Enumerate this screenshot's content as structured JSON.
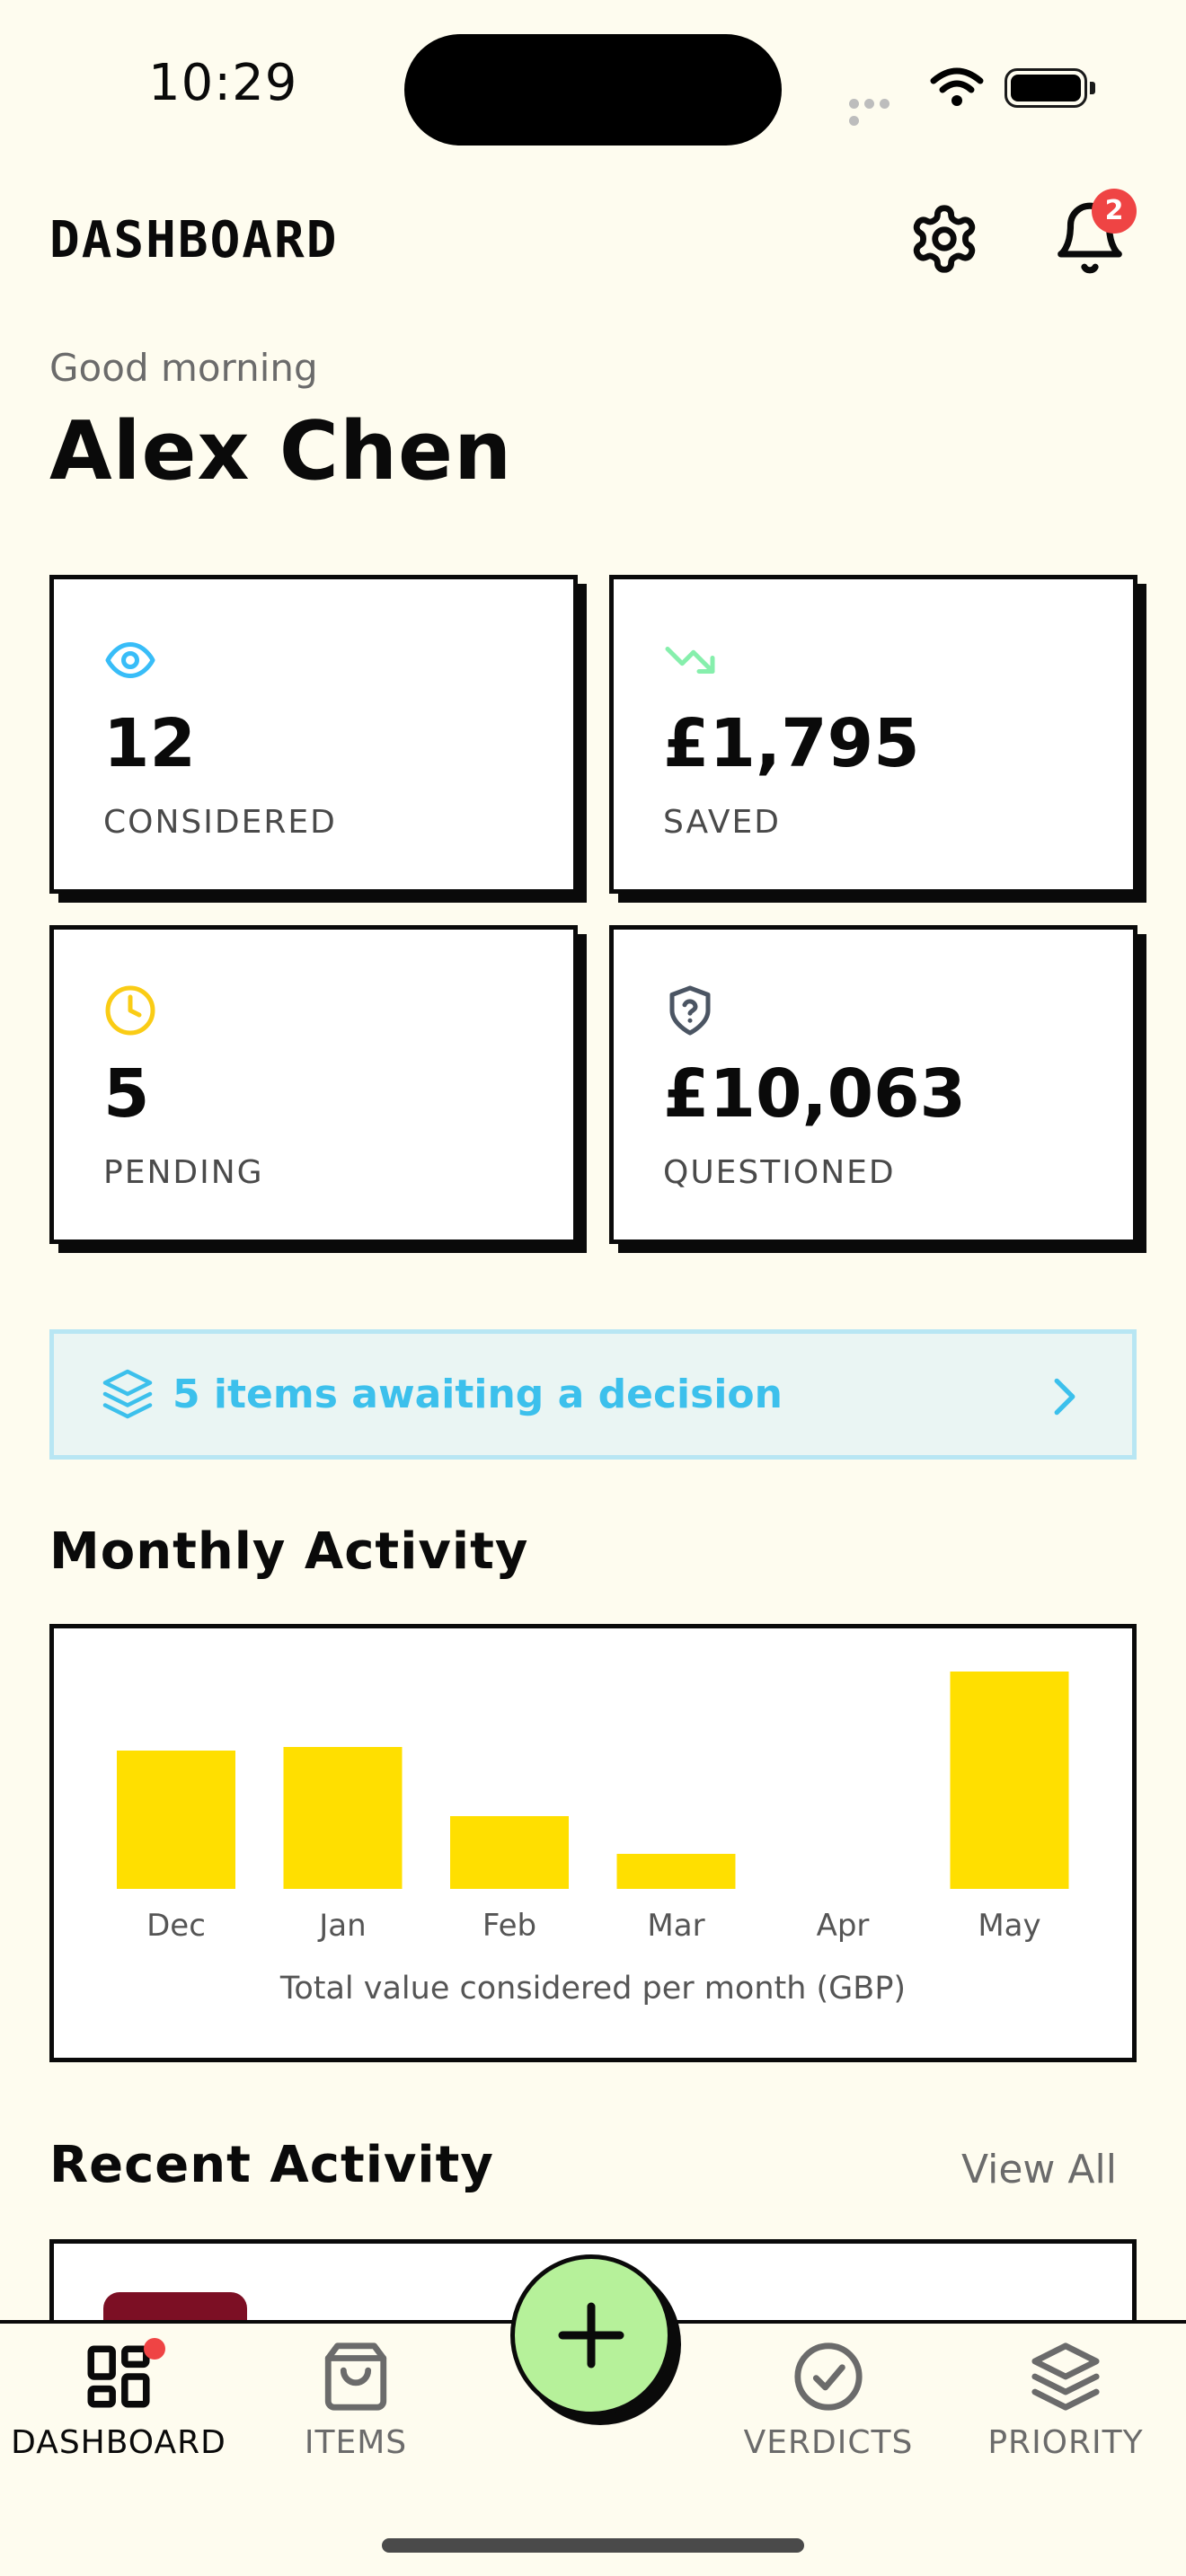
{
  "status_bar": {
    "time": "10:29"
  },
  "header": {
    "title": "DASHBOARD",
    "notification_count": "2"
  },
  "greeting": {
    "salutation": "Good morning",
    "name": "Alex Chen"
  },
  "stats": [
    {
      "value": "12",
      "label": "CONSIDERED",
      "icon": "eye-icon",
      "color": "#38bdf8"
    },
    {
      "value": "£1,795",
      "label": "SAVED",
      "icon": "trending-down-icon",
      "color": "#86efac"
    },
    {
      "value": "5",
      "label": "PENDING",
      "icon": "clock-icon",
      "color": "#facc15"
    },
    {
      "value": "£10,063",
      "label": "QUESTIONED",
      "icon": "shield-question-icon",
      "color": "#4b5563"
    }
  ],
  "awaiting": {
    "text": "5 items awaiting a decision",
    "icon": "layers-icon"
  },
  "monthly": {
    "title": "Monthly Activity"
  },
  "chart_data": {
    "type": "bar",
    "categories": [
      "Dec",
      "Jan",
      "Feb",
      "Mar",
      "Apr",
      "May"
    ],
    "values": [
      1540,
      1580,
      810,
      390,
      0,
      2420
    ],
    "xlabel": "Total value considered per month (GBP)",
    "ylabel": "",
    "bar_color": "#ffdf00",
    "ylim": [
      0,
      2420
    ],
    "grid": false
  },
  "recent": {
    "title": "Recent Activity",
    "view_all": "View All"
  },
  "tabs": [
    {
      "label": "DASHBOARD",
      "icon": "dashboard-icon",
      "active": true
    },
    {
      "label": "ITEMS",
      "icon": "shopping-bag-icon",
      "active": false
    },
    {
      "label": "VERDICTS",
      "icon": "check-circle-icon",
      "active": false
    },
    {
      "label": "PRIORITY",
      "icon": "layers-icon",
      "active": false
    }
  ],
  "colors": {
    "background": "#fefcef",
    "accent_green": "#b6f19a",
    "badge_red": "#ef4444",
    "chart_yellow": "#ffdf00",
    "info_blue": "#3cc0ec"
  }
}
